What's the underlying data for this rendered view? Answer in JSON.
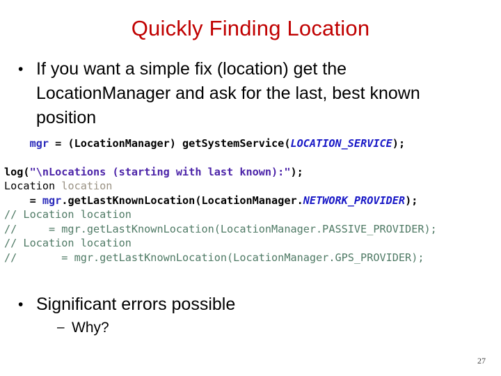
{
  "slide": {
    "title": "Quickly Finding Location",
    "title_color": "#c00000",
    "background_color": "#ffffff",
    "page_number": "27"
  },
  "bullets_top": [
    {
      "level": 1,
      "marker": "•",
      "text": "If you want a simple fix (location) get the LocationManager and ask for the last, best known position"
    }
  ],
  "bullets_bottom": [
    {
      "level": 1,
      "marker": "•",
      "text": "Significant errors possible"
    },
    {
      "level": 2,
      "marker": "–",
      "text": "Why?"
    }
  ],
  "code": {
    "language": "java",
    "colors": {
      "plain": "#000000",
      "variable": "#2b2bbb",
      "constant": "#1717c6",
      "string": "#4b23a8",
      "type": "#000000",
      "local_variable": "#9a9284",
      "comment": "#4f7a65"
    },
    "lines": [
      {
        "id": "line-1",
        "text": "    mgr = (LocationManager) getSystemService(LOCATION_SERVICE);",
        "tokens": [
          {
            "t": "    ",
            "c": "plain"
          },
          {
            "t": "mgr",
            "c": "var"
          },
          {
            "t": " = (LocationManager) getSystemService(",
            "c": "plain"
          },
          {
            "t": "LOCATION_SERVICE",
            "c": "const"
          },
          {
            "t": ");",
            "c": "plain"
          }
        ]
      },
      {
        "id": "line-2",
        "text": "",
        "tokens": []
      },
      {
        "id": "line-3",
        "text": "log(\"\\nLocations (starting with last known):\");",
        "tokens": [
          {
            "t": "log(",
            "c": "plain"
          },
          {
            "t": "\"\\nLocations (starting with last known):\"",
            "c": "string"
          },
          {
            "t": ");",
            "c": "plain"
          }
        ]
      },
      {
        "id": "line-4",
        "text": "Location location",
        "tokens": [
          {
            "t": "Location ",
            "c": "type"
          },
          {
            "t": "location",
            "c": "localvar"
          }
        ]
      },
      {
        "id": "line-5",
        "text": "    = mgr.getLastKnownLocation(LocationManager.NETWORK_PROVIDER);",
        "tokens": [
          {
            "t": "    = ",
            "c": "plain"
          },
          {
            "t": "mgr",
            "c": "var"
          },
          {
            "t": ".getLastKnownLocation(LocationManager.",
            "c": "plain"
          },
          {
            "t": "NETWORK_PROVIDER",
            "c": "const"
          },
          {
            "t": ");",
            "c": "plain"
          }
        ]
      },
      {
        "id": "line-6",
        "text": "// Location location",
        "tokens": [
          {
            "t": "// Location location",
            "c": "comment"
          }
        ]
      },
      {
        "id": "line-7",
        "text": "//     = mgr.getLastKnownLocation(LocationManager.PASSIVE_PROVIDER);",
        "tokens": [
          {
            "t": "//     = mgr.getLastKnownLocation(LocationManager.PASSIVE_PROVIDER);",
            "c": "comment"
          }
        ]
      },
      {
        "id": "line-8",
        "text": "// Location location",
        "tokens": [
          {
            "t": "// Location location",
            "c": "comment"
          }
        ]
      },
      {
        "id": "line-9",
        "text": "//       = mgr.getLastKnownLocation(LocationManager.GPS_PROVIDER);",
        "tokens": [
          {
            "t": "//       = mgr.getLastKnownLocation(LocationManager.GPS_PROVIDER);",
            "c": "comment"
          }
        ]
      }
    ]
  }
}
